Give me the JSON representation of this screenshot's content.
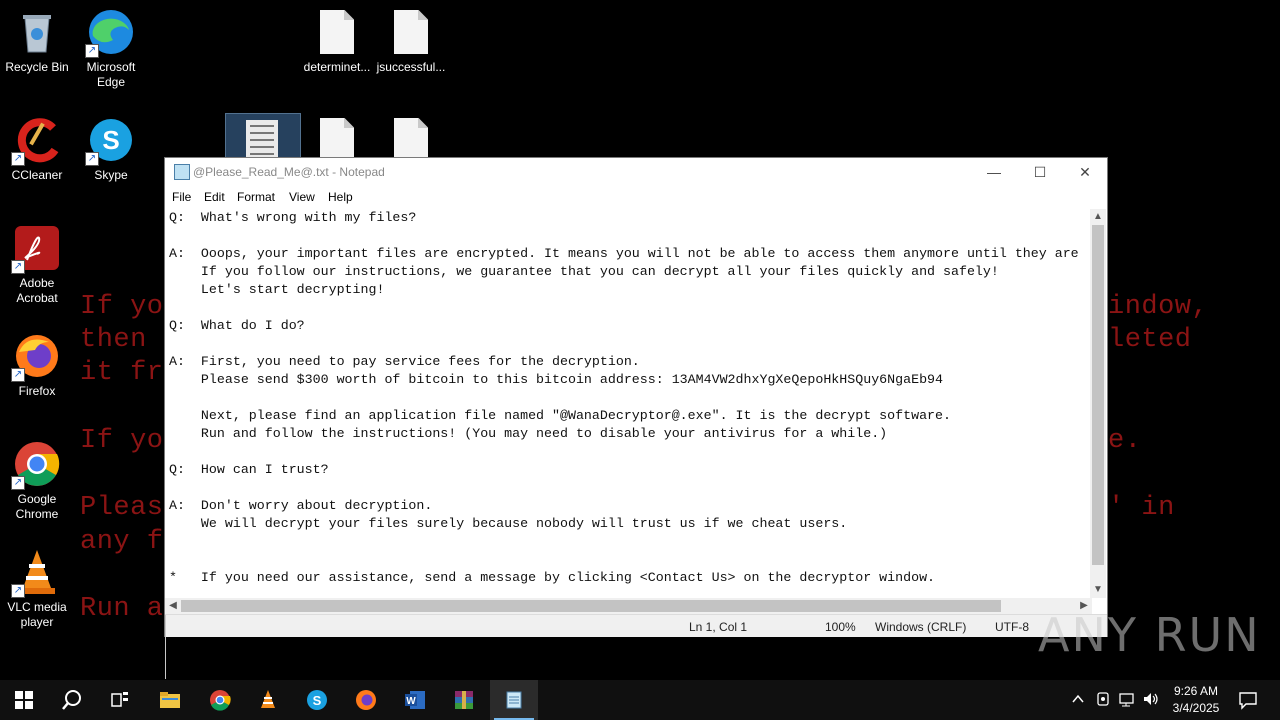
{
  "wallpaper": {
    "lines": [
      {
        "text": "If yo",
        "right": "indow,"
      },
      {
        "text": "then ",
        "right": "leted"
      },
      {
        "text": "it fr",
        "right": ""
      },
      {
        "text": "If yo",
        "right": "e."
      },
      {
        "text": "Pleas",
        "right": "' in"
      },
      {
        "text": "any f",
        "right": ""
      },
      {
        "text": "Run a",
        "right": ""
      }
    ]
  },
  "desktop": {
    "icons": [
      {
        "name": "recycle-bin",
        "label": "Recycle Bin"
      },
      {
        "name": "microsoft-edge",
        "label": "Microsoft Edge"
      },
      {
        "name": "ccleaner",
        "label": "CCleaner"
      },
      {
        "name": "skype",
        "label": "Skype"
      },
      {
        "name": "adobe-acrobat",
        "label": "Adobe Acrobat"
      },
      {
        "name": "firefox",
        "label": "Firefox"
      },
      {
        "name": "google-chrome",
        "label": "Google Chrome"
      },
      {
        "name": "vlc-media-player",
        "label": "VLC media player"
      }
    ],
    "files": [
      {
        "label": "determinet..."
      },
      {
        "label": "jsuccessful..."
      }
    ]
  },
  "notepad": {
    "title": "@Please_Read_Me@.txt - Notepad",
    "controls": {
      "minimize": "—",
      "maximize": "☐",
      "close": "✕"
    },
    "menu": [
      "File",
      "Edit",
      "Format",
      "View",
      "Help"
    ],
    "content": "Q:  What's wrong with my files?\n\nA:  Ooops, your important files are encrypted. It means you will not be able to access them anymore until they are\n    If you follow our instructions, we guarantee that you can decrypt all your files quickly and safely!\n    Let's start decrypting!\n\nQ:  What do I do?\n\nA:  First, you need to pay service fees for the decryption.\n    Please send $300 worth of bitcoin to this bitcoin address: 13AM4VW2dhxYgXeQepoHkHSQuy6NgaEb94\n\n    Next, please find an application file named \"@WanaDecryptor@.exe\". It is the decrypt software.\n    Run and follow the instructions! (You may need to disable your antivirus for a while.)\n\nQ:  How can I trust?\n\nA:  Don't worry about decryption.\n    We will decrypt your files surely because nobody will trust us if we cheat users.\n\n\n*   If you need our assistance, send a message by clicking <Contact Us> on the decryptor window.",
    "status": {
      "position": "Ln 1, Col 1",
      "zoom": "100%",
      "line_ending": "Windows (CRLF)",
      "encoding": "UTF-8"
    }
  },
  "taskbar": {
    "apps": [
      "start",
      "search",
      "task-view",
      "file-explorer",
      "chrome",
      "vlc",
      "skype",
      "firefox",
      "word",
      "winrar",
      "notepad"
    ],
    "clock": {
      "time": "9:26 AM",
      "date": "3/4/2025"
    }
  },
  "watermark": "ANY RUN"
}
